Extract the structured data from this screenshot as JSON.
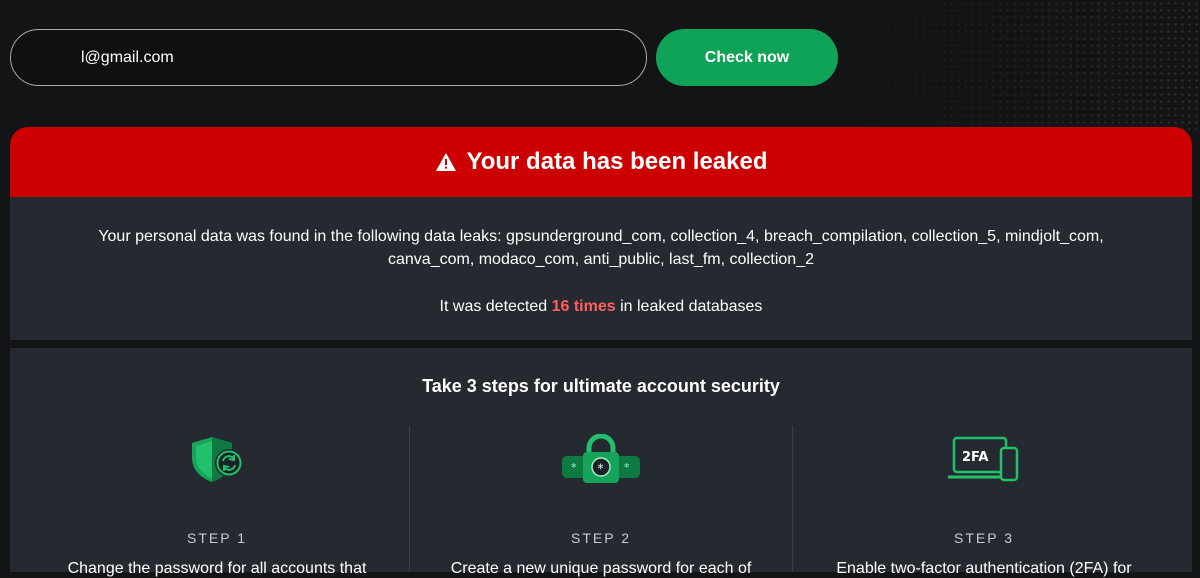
{
  "search": {
    "email_value": "l@gmail.com",
    "button_label": "Check now"
  },
  "leak": {
    "title": "Your data has been leaked",
    "found_text": "Your personal data was found in the following data leaks: gpsunderground_com, collection_4, breach_compilation, collection_5, mindjolt_com, canva_com, modaco_com, anti_public, last_fm, collection_2",
    "detected_prefix": "It was detected ",
    "detected_count": "16 times",
    "detected_suffix": " in leaked databases"
  },
  "steps": {
    "title": "Take 3 steps for ultimate account security",
    "items": [
      {
        "label": "STEP 1",
        "icon": "shield-refresh-icon",
        "text": "Change the password for all accounts that"
      },
      {
        "label": "STEP 2",
        "icon": "padlock-password-icon",
        "text": "Create a new unique password for each of"
      },
      {
        "label": "STEP 3",
        "icon": "2fa-device-icon",
        "icon_text": "2FA",
        "text": "Enable two-factor authentication (2FA) for"
      }
    ]
  },
  "colors": {
    "alert_red": "#cc0000",
    "accent_green": "#0ea356",
    "highlight_red": "#ff5f5f",
    "card_bg": "#252a30",
    "page_bg": "#131416"
  }
}
